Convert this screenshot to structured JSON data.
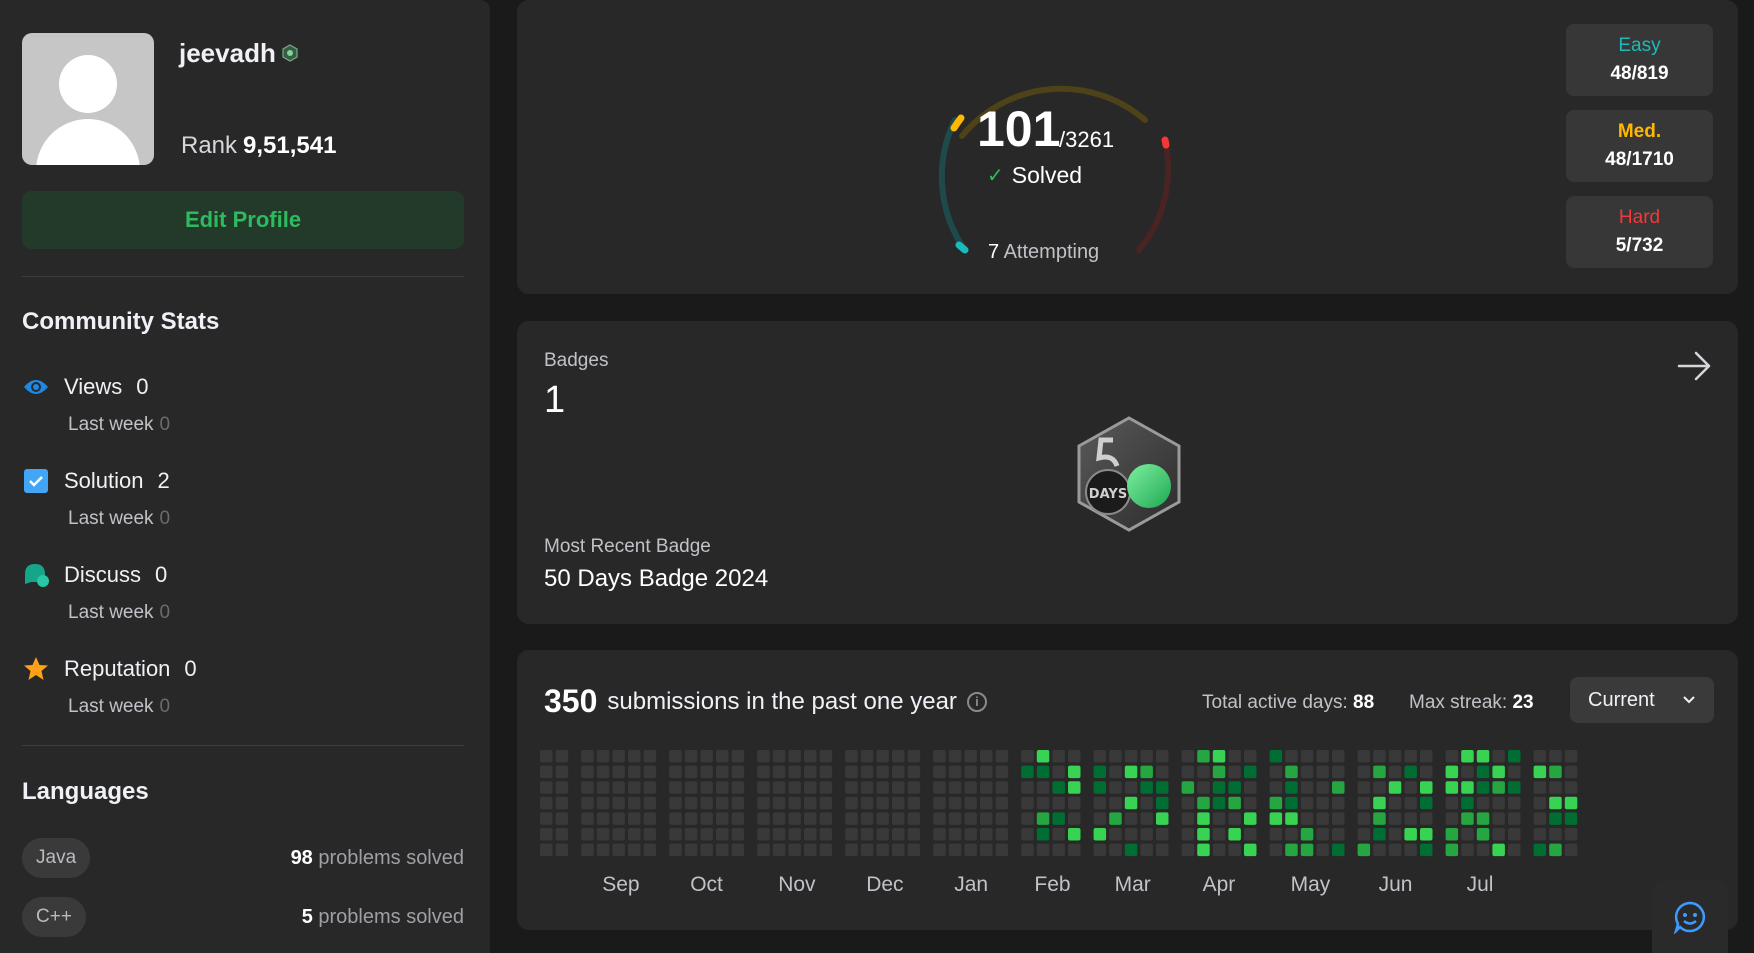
{
  "profile": {
    "username": "jeevadh",
    "rank_label": "Rank",
    "rank_value": "9,51,541",
    "edit_label": "Edit Profile"
  },
  "community": {
    "title": "Community Stats",
    "stats": [
      {
        "label": "Views",
        "value": "0",
        "sub_label": "Last week",
        "sub_value": "0",
        "icon": "eye-icon"
      },
      {
        "label": "Solution",
        "value": "2",
        "sub_label": "Last week",
        "sub_value": "0",
        "icon": "checkbox-icon"
      },
      {
        "label": "Discuss",
        "value": "0",
        "sub_label": "Last week",
        "sub_value": "0",
        "icon": "discuss-icon"
      },
      {
        "label": "Reputation",
        "value": "0",
        "sub_label": "Last week",
        "sub_value": "0",
        "icon": "star-icon"
      }
    ]
  },
  "languages": {
    "title": "Languages",
    "items": [
      {
        "name": "Java",
        "count": "98",
        "suffix": "problems solved"
      },
      {
        "name": "C++",
        "count": "5",
        "suffix": "problems solved"
      }
    ]
  },
  "solved": {
    "count": "101",
    "total": "/3261",
    "label": "Solved",
    "attempting_count": "7",
    "attempting_label": "Attempting",
    "difficulties": [
      {
        "name": "Easy",
        "count": "48/819",
        "color": "#1cbaba"
      },
      {
        "name": "Med.",
        "count": "48/1710",
        "color": "#ffb700"
      },
      {
        "name": "Hard",
        "count": "5/732",
        "color": "#f63737"
      }
    ]
  },
  "badges": {
    "label": "Badges",
    "count": "1",
    "recent_label": "Most Recent Badge",
    "recent_name": "50 Days Badge 2024",
    "badge_text": "DAYS"
  },
  "submissions": {
    "count": "350",
    "label": "submissions in the past one year",
    "active_days_label": "Total active days:",
    "active_days": "88",
    "max_streak_label": "Max streak:",
    "max_streak": "23",
    "dropdown_value": "Current",
    "months": [
      "Sep",
      "Oct",
      "Nov",
      "Dec",
      "Jan",
      "Feb",
      "Mar",
      "Apr",
      "May",
      "Jun",
      "Jul"
    ]
  }
}
